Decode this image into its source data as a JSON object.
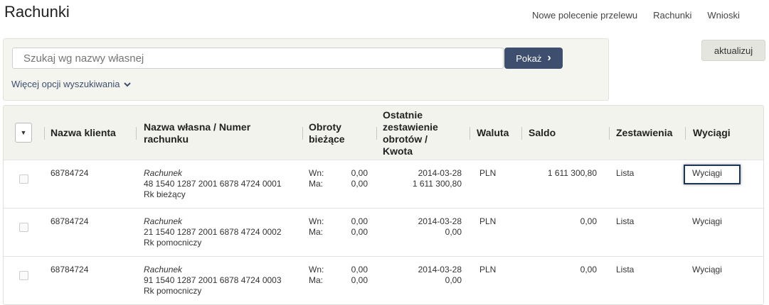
{
  "page": {
    "title": "Rachunki"
  },
  "topnav": [
    "Nowe polecenie przelewu",
    "Rachunki",
    "Wnioski"
  ],
  "search": {
    "placeholder": "Szukaj wg nazwy własnej",
    "show_label": "Pokaż",
    "more_label": "Więcej opcji wyszukiwania",
    "refresh_label": "aktualizuj"
  },
  "headers": {
    "client": "Nazwa klienta",
    "name_number_1": "Nazwa własna / Numer",
    "name_number_2": "rachunku",
    "turnover_1": "Obroty",
    "turnover_2": "bieżące",
    "last_1": "Ostatnie",
    "last_2": "zestawienie",
    "last_3": "obrotów /",
    "last_4": "Kwota",
    "currency": "Waluta",
    "balance": "Saldo",
    "statements": "Zestawienia",
    "extracts": "Wyciągi"
  },
  "labels": {
    "wn": "Wn:",
    "ma": "Ma:"
  },
  "rows": [
    {
      "client": "68784724",
      "type": "Rachunek",
      "number": "48 1540 1287 2001 6878 4724 0001",
      "kind": "Rk bieżący",
      "wn": "0,00",
      "ma": "0,00",
      "date": "2014-03-28",
      "amount": "1 611 300,80",
      "currency": "PLN",
      "balance": "1 611 300,80",
      "list": "Lista",
      "extracts": "Wyciągi"
    },
    {
      "client": "68784724",
      "type": "Rachunek",
      "number": "21 1540 1287 2001 6878 4724 0002",
      "kind": "Rk pomocniczy",
      "wn": "0,00",
      "ma": "0,00",
      "date": "2014-03-28",
      "amount": "0,00",
      "currency": "PLN",
      "balance": "0,00",
      "list": "Lista",
      "extracts": "Wyciągi"
    },
    {
      "client": "68784724",
      "type": "Rachunek",
      "number": "91 1540 1287 2001 6878 4724 0003",
      "kind": "Rk pomocniczy",
      "wn": "0,00",
      "ma": "0,00",
      "date": "2014-03-28",
      "amount": "0,00",
      "currency": "PLN",
      "balance": "0,00",
      "list": "Lista",
      "extracts": "Wyciągi"
    }
  ],
  "colors": {
    "primary": "#3d4e6e",
    "panel": "#f5f5f0",
    "highlight": "#1d3557"
  },
  "icons": {
    "show_chevron": "chevron-right-icon",
    "more_chevron": "chevron-down-icon",
    "dropdown": "caret-down-icon"
  }
}
